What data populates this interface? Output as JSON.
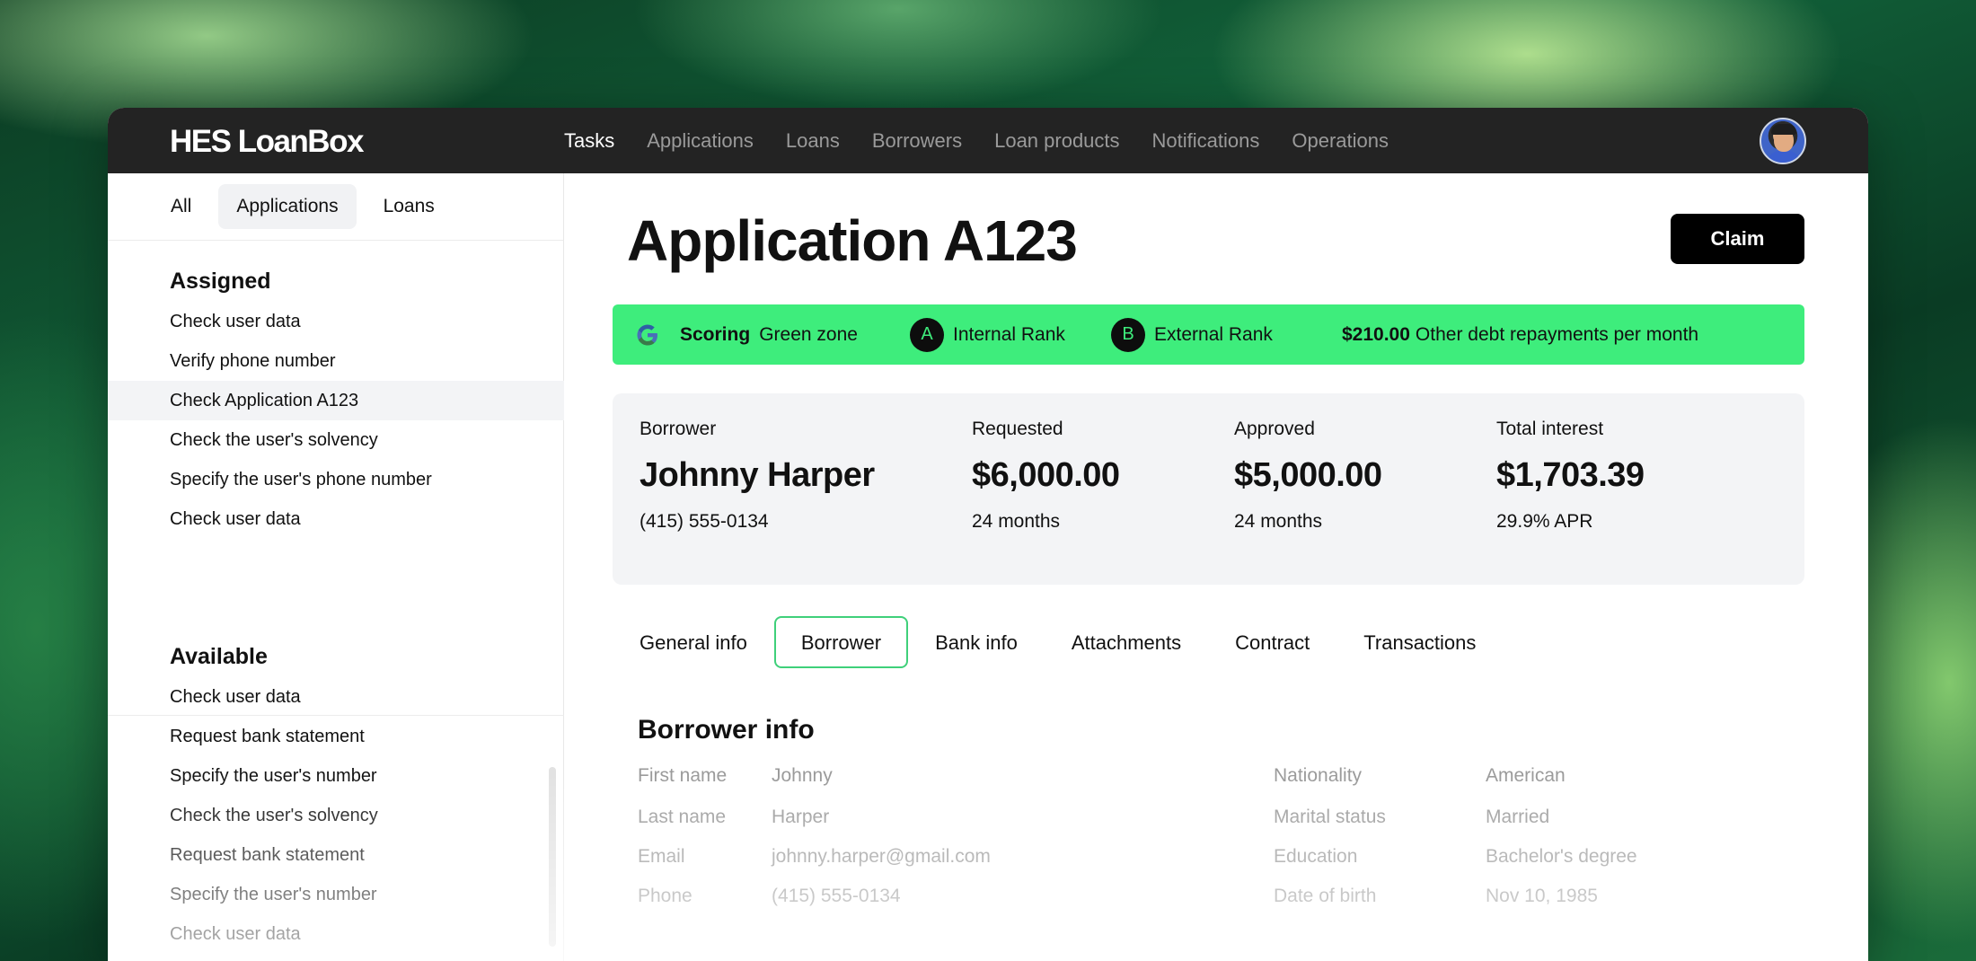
{
  "app": {
    "title": "HES LoanBox"
  },
  "nav": {
    "items": [
      "Tasks",
      "Applications",
      "Loans",
      "Borrowers",
      "Loan products",
      "Notifications",
      "Operations"
    ],
    "active": "Tasks"
  },
  "sidebar": {
    "filters": [
      "All",
      "Applications",
      "Loans"
    ],
    "active_filter": "Applications",
    "assigned": {
      "title": "Assigned",
      "items": [
        "Check user data",
        "Verify phone number",
        "Check Application A123",
        "Check the user's solvency",
        "Specify the user's phone number",
        "Check user data"
      ],
      "selected_index": 2
    },
    "available": {
      "title": "Available",
      "items": [
        "Check user data",
        "Request bank statement",
        "Specify the user's number",
        "Check the user's solvency",
        "Request bank statement",
        "Specify the user's number",
        "Check user data"
      ]
    }
  },
  "main": {
    "title": "Application A123",
    "claim_label": "Claim",
    "scoring": {
      "label": "Scoring",
      "zone": "Green zone",
      "internal_rank_letter": "A",
      "internal_rank_label": "Internal Rank",
      "external_rank_letter": "B",
      "external_rank_label": "External Rank",
      "debt_amount": "$210.00",
      "debt_label": "Other debt repayments per month"
    },
    "summary": {
      "borrower": {
        "label": "Borrower",
        "value": "Johnny Harper",
        "sub": "(415) 555-0134"
      },
      "requested": {
        "label": "Requested",
        "value": "$6,000.00",
        "sub": "24 months"
      },
      "approved": {
        "label": "Approved",
        "value": "$5,000.00",
        "sub": "24 months"
      },
      "interest": {
        "label": "Total interest",
        "value": "$1,703.39",
        "sub": "29.9% APR"
      }
    },
    "tabs": [
      "General info",
      "Borrower",
      "Bank info",
      "Attachments",
      "Contract",
      "Transactions"
    ],
    "active_tab": "Borrower",
    "borrower_info": {
      "title": "Borrower info",
      "left": [
        {
          "label": "First name",
          "value": "Johnny"
        },
        {
          "label": "Last name",
          "value": "Harper"
        },
        {
          "label": "Email",
          "value": "johnny.harper@gmail.com"
        },
        {
          "label": "Phone",
          "value": "(415) 555-0134"
        }
      ],
      "right": [
        {
          "label": "Nationality",
          "value": "American"
        },
        {
          "label": "Marital status",
          "value": "Married"
        },
        {
          "label": "Education",
          "value": "Bachelor's degree"
        },
        {
          "label": "Date of birth",
          "value": "Nov 10, 1985"
        }
      ]
    }
  },
  "colors": {
    "accent_green": "#3eed7c",
    "topbar": "#232323",
    "tab_border": "#3fd07a"
  },
  "icons": {
    "scoring": "google-g-icon",
    "avatar": "user-avatar"
  }
}
